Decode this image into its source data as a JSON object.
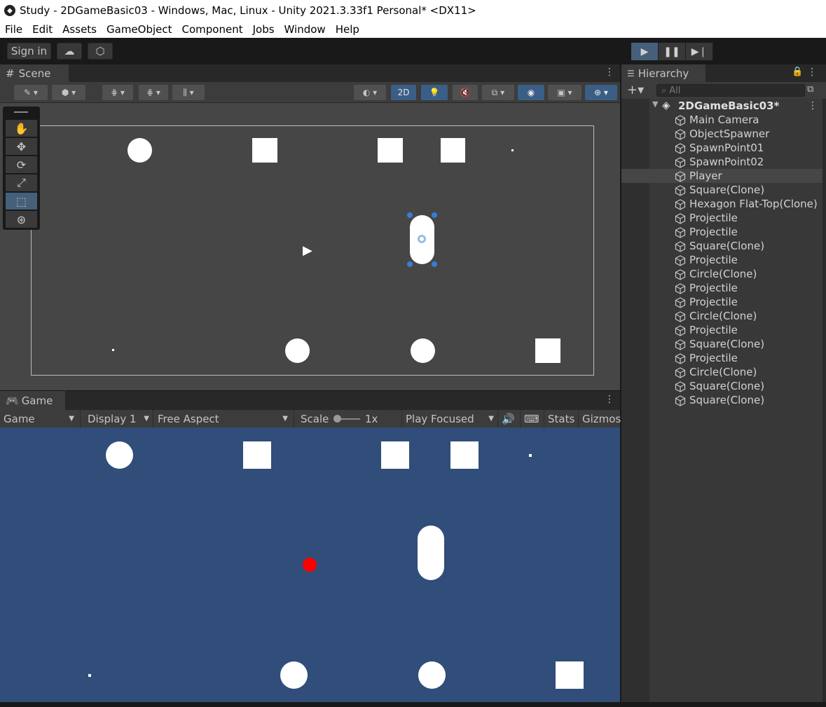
{
  "window": {
    "title": "Study - 2DGameBasic03 - Windows, Mac, Linux - Unity 2021.3.33f1 Personal* <DX11>"
  },
  "menu": [
    "File",
    "Edit",
    "Assets",
    "GameObject",
    "Component",
    "Jobs",
    "Window",
    "Help"
  ],
  "toolbar": {
    "sign_in": "Sign in",
    "cloud_icon": "cloud-icon",
    "collab_icon": "collab-icon"
  },
  "playback": {
    "play": "play-icon",
    "pause": "pause-icon",
    "step": "step-icon",
    "playing": true
  },
  "scene": {
    "tab_label": "Scene",
    "toggle_2d": "2D",
    "objects": [
      {
        "kind": "circle",
        "name": "scene-circle-1"
      },
      {
        "kind": "square",
        "name": "scene-square-1"
      },
      {
        "kind": "square",
        "name": "scene-square-2"
      },
      {
        "kind": "square",
        "name": "scene-square-3"
      }
    ]
  },
  "game": {
    "tab_label": "Game",
    "view_select": "Game",
    "display": "Display 1",
    "aspect": "Free Aspect",
    "scale_label": "Scale",
    "scale_value": "1x",
    "play_mode": "Play Focused",
    "stats": "Stats",
    "gizmos": "Gizmos",
    "colors": {
      "background": "#314d79",
      "ball": "#ff0000"
    }
  },
  "hierarchy": {
    "tab_label": "Hierarchy",
    "search_placeholder": "All",
    "root": "2DGameBasic03*",
    "selected": "Player",
    "items": [
      "Main Camera",
      "ObjectSpawner",
      "SpawnPoint01",
      "SpawnPoint02",
      "Player",
      "Square(Clone)",
      "Hexagon Flat-Top(Clone)",
      "Projectile",
      "Projectile",
      "Square(Clone)",
      "Projectile",
      "Circle(Clone)",
      "Projectile",
      "Projectile",
      "Circle(Clone)",
      "Projectile",
      "Square(Clone)",
      "Projectile",
      "Circle(Clone)",
      "Square(Clone)",
      "Square(Clone)"
    ]
  }
}
